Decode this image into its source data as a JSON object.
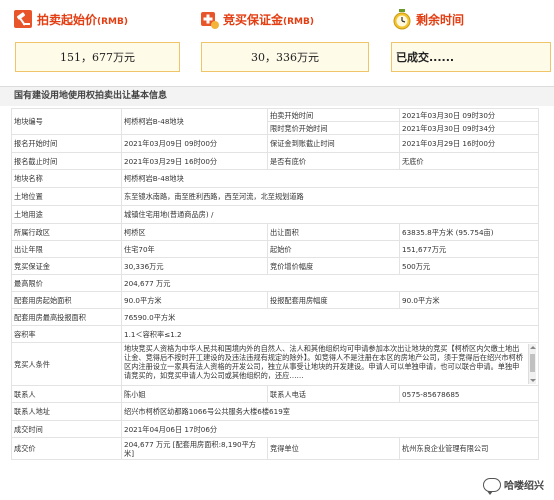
{
  "summary": {
    "start_price": {
      "label": "拍卖起始价",
      "unit": "(RMB)",
      "value": "151，677万元"
    },
    "deposit": {
      "label": "竞买保证金",
      "unit": "(RMB)",
      "value": "30，336万元"
    },
    "time_left": {
      "label": "剩余时间",
      "value": "已成交......"
    }
  },
  "section_title": "国有建设用地使用权拍卖出让基本信息",
  "rows": {
    "r1": {
      "k1": "地块编号",
      "v1": "柯桥柯岩B-48地块",
      "k2a": "拍卖开始时间",
      "v2a": "2021年03月30日 09时30分",
      "k2b": "限时竞价开始时间",
      "v2b": "2021年03月30日 09时34分"
    },
    "r2": {
      "k1": "报名开始时间",
      "v1": "2021年03月09日 09时00分",
      "k2": "保证金到账截止时间",
      "v2": "2021年03月29日 16时00分"
    },
    "r3": {
      "k1": "报名截止时间",
      "v1": "2021年03月29日 16时00分",
      "k2": "是否有底价",
      "v2": "无底价"
    },
    "r4": {
      "k1": "地块名称",
      "v1": "柯桥柯岩B-48地块"
    },
    "r5": {
      "k1": "土地位置",
      "v1": "东至镜水南路，南至胜利西路，西至河流，北至规划道路"
    },
    "r6": {
      "k1": "土地用途",
      "v1": "城镇住宅用地(普通商品房) /"
    },
    "r7": {
      "k1": "所属行政区",
      "v1": "柯桥区",
      "k2": "出让面积",
      "v2": "63835.8平方米 (95.754亩)"
    },
    "r8": {
      "k1": "出让年限",
      "v1": "住宅70年",
      "k2": "起始价",
      "v2": "151,677万元"
    },
    "r9": {
      "k1": "竞买保证金",
      "v1": "30,336万元",
      "k2": "竞价增价幅度",
      "v2": "500万元"
    },
    "r10": {
      "k1": "最高限价",
      "v1": "204,677 万元"
    },
    "r11": {
      "k1": "配套用房起始面积",
      "v1": "90.0平方米",
      "k2": "投报配套用房幅度",
      "v2": "90.0平方米"
    },
    "r12": {
      "k1": "配套用房最高投报面积",
      "v1": "76590.0平方米"
    },
    "r13": {
      "k1": "容积率",
      "v1": "1.1＜容积率≤1.2"
    },
    "r14": {
      "k1": "竞买人条件",
      "v1": "地块竞买人资格为中华人民共和国境内外的自然人、法人和其他组织均可申请参加本次出让地块的竞买【柯桥区内欠缴土地出让金、竞得后不按时开工建设的及违法违规有规定的除外】。如竞得人不是注册在本区的房地产公司，须于竞得后在绍兴市柯桥区内注册设立一家具有法人资格的开发公司，独立从事受让地块的开发建设。申请人可以单独申请，也可以联合申请。单独申请竞买的，如竞买申请人为公司或其他组织的，还应……"
    },
    "r15": {
      "k1": "联系人",
      "v1": "陈小姐",
      "k2": "联系人电话",
      "v2": "0575-85678685"
    },
    "r16": {
      "k1": "联系人地址",
      "v1": "绍兴市柯桥区幼都路1066号公共服务大楼6楼619室"
    },
    "r17": {
      "k1": "成交时间",
      "v1": "2021年04月06日 17时06分"
    },
    "r18": {
      "k1": "成交价",
      "v1": "204,677 万元 [配套用房面积:8,190平方米]",
      "k2": "竞得单位",
      "v2": "杭州东良企业管理有限公司"
    }
  },
  "watermark": "哈喽绍兴",
  "colors": {
    "accent": "#e33d12",
    "box_border": "#f0c56a",
    "box_bg": "#fffbe9"
  }
}
